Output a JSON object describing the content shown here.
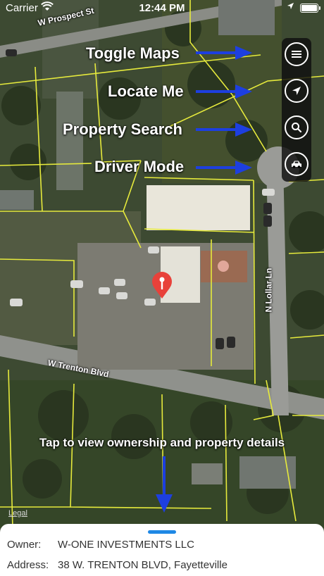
{
  "status_bar": {
    "carrier": "Carrier",
    "time": "12:44 PM"
  },
  "map": {
    "streets": {
      "prospect": "W Prospect St",
      "trenton": "W Trenton Blvd",
      "lollar": "N Lollar Ln"
    },
    "legal_link": "Legal"
  },
  "toolbar": [
    {
      "id": "toggle",
      "icon": "menu-icon"
    },
    {
      "id": "locate",
      "icon": "location-arrow-icon"
    },
    {
      "id": "search",
      "icon": "search-icon"
    },
    {
      "id": "driver",
      "icon": "car-icon"
    }
  ],
  "callouts": {
    "toggle_maps": "Toggle Maps",
    "locate_me": "Locate Me",
    "property_search": "Property Search",
    "driver_mode": "Driver Mode",
    "tap_hint": "Tap to view ownership and property details"
  },
  "details": {
    "owner_label": "Owner:",
    "owner_value": "W-ONE INVESTMENTS LLC",
    "address_label": "Address:",
    "address_value": "38 W. TRENTON BLVD, Fayetteville"
  },
  "colors": {
    "parcel_lines": "#e6ea3c",
    "arrows": "#1d3fe0",
    "pin": "#e8413a",
    "sheet_handle": "#1e88e5"
  }
}
